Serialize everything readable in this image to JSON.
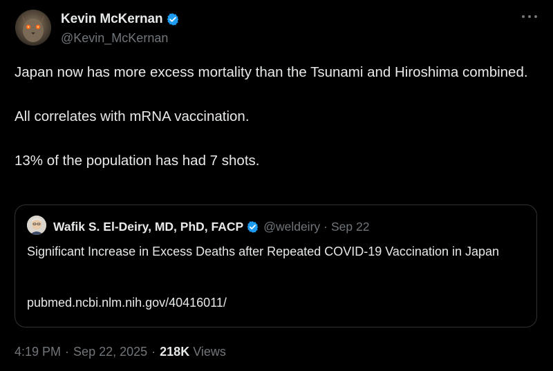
{
  "tweet": {
    "author": {
      "name": "Kevin McKernan",
      "handle": "@Kevin_McKernan",
      "verified_icon": "verified-badge-icon",
      "verified_color": "#1d9bf0"
    },
    "text_lines": [
      "Japan now has more excess mortality than the Tsunami and Hiroshima combined.",
      "All correlates with mRNA vaccination.",
      "13% of the population has had 7 shots."
    ],
    "quote": {
      "name": "Wafik S. El-Deiry, MD, PhD, FACP",
      "handle": "@weldeiry",
      "dot": "·",
      "date": "Sep 22",
      "text": "Significant Increase in Excess Deaths after Repeated COVID-19 Vaccination in Japan",
      "link": "pubmed.ncbi.nlm.nih.gov/40416011/"
    },
    "meta": {
      "time": "4:19 PM",
      "sep1": "·",
      "date": "Sep 22, 2025",
      "sep2": "·",
      "views_count": "218K",
      "views_label": "Views"
    },
    "icons": {
      "more": "more-horizontal-icon"
    },
    "colors": {
      "background": "#000000",
      "primary_text": "#e7e9ea",
      "secondary_text": "#71767b",
      "border": "#2f3336"
    }
  }
}
